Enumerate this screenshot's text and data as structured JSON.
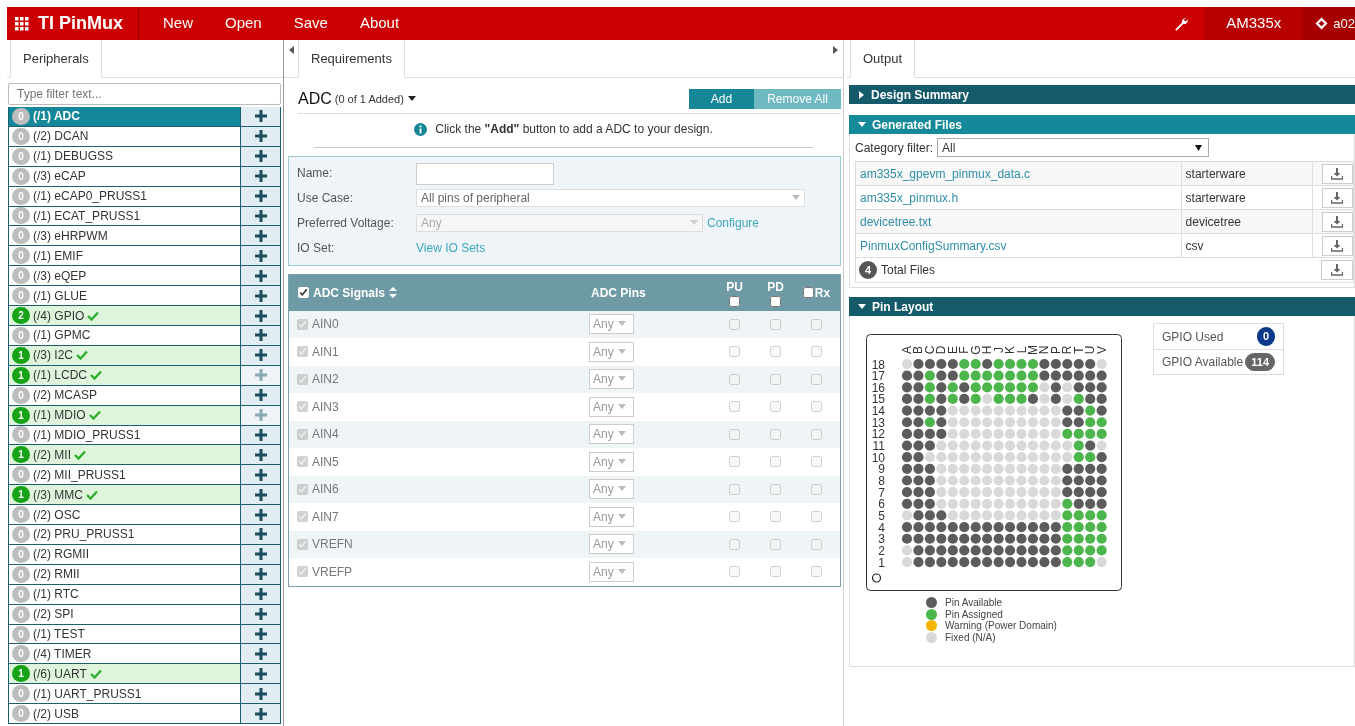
{
  "header": {
    "brand": "TI PinMux",
    "menu": [
      "New",
      "Open",
      "Save",
      "About"
    ],
    "device": "AM335x",
    "user": "a02"
  },
  "peripherals": {
    "tab": {
      "label": "Peripherals",
      "selected": true
    },
    "filter": {
      "placeholder": "Type filter text..."
    },
    "items": [
      {
        "count": "0",
        "label": "(/1) ADC",
        "assigned": false,
        "selected": true,
        "add_disabled": false
      },
      {
        "count": "0",
        "label": "(/2) DCAN",
        "assigned": false,
        "selected": false,
        "add_disabled": false
      },
      {
        "count": "0",
        "label": "(/1) DEBUGSS",
        "assigned": false,
        "selected": false,
        "add_disabled": false
      },
      {
        "count": "0",
        "label": "(/3) eCAP",
        "assigned": false,
        "selected": false,
        "add_disabled": false
      },
      {
        "count": "0",
        "label": "(/1) eCAP0_PRUSS1",
        "assigned": false,
        "selected": false,
        "add_disabled": false
      },
      {
        "count": "0",
        "label": "(/1) ECAT_PRUSS1",
        "assigned": false,
        "selected": false,
        "add_disabled": false
      },
      {
        "count": "0",
        "label": "(/3) eHRPWM",
        "assigned": false,
        "selected": false,
        "add_disabled": false
      },
      {
        "count": "0",
        "label": "(/1) EMIF",
        "assigned": false,
        "selected": false,
        "add_disabled": false
      },
      {
        "count": "0",
        "label": "(/3) eQEP",
        "assigned": false,
        "selected": false,
        "add_disabled": false
      },
      {
        "count": "0",
        "label": "(/1) GLUE",
        "assigned": false,
        "selected": false,
        "add_disabled": false
      },
      {
        "count": "2",
        "label": "(/4) GPIO",
        "assigned": true,
        "selected": false,
        "add_disabled": false
      },
      {
        "count": "0",
        "label": "(/1) GPMC",
        "assigned": false,
        "selected": false,
        "add_disabled": false
      },
      {
        "count": "1",
        "label": "(/3) I2C",
        "assigned": true,
        "selected": false,
        "add_disabled": false
      },
      {
        "count": "1",
        "label": "(/1) LCDC",
        "assigned": true,
        "selected": false,
        "add_disabled": true
      },
      {
        "count": "0",
        "label": "(/2) MCASP",
        "assigned": false,
        "selected": false,
        "add_disabled": false
      },
      {
        "count": "1",
        "label": "(/1) MDIO",
        "assigned": true,
        "selected": false,
        "add_disabled": true
      },
      {
        "count": "0",
        "label": "(/1) MDIO_PRUSS1",
        "assigned": false,
        "selected": false,
        "add_disabled": false
      },
      {
        "count": "1",
        "label": "(/2) MII",
        "assigned": true,
        "selected": false,
        "add_disabled": false
      },
      {
        "count": "0",
        "label": "(/2) MII_PRUSS1",
        "assigned": false,
        "selected": false,
        "add_disabled": false
      },
      {
        "count": "1",
        "label": "(/3) MMC",
        "assigned": true,
        "selected": false,
        "add_disabled": false
      },
      {
        "count": "0",
        "label": "(/2) OSC",
        "assigned": false,
        "selected": false,
        "add_disabled": false
      },
      {
        "count": "0",
        "label": "(/2) PRU_PRUSS1",
        "assigned": false,
        "selected": false,
        "add_disabled": false
      },
      {
        "count": "0",
        "label": "(/2) RGMII",
        "assigned": false,
        "selected": false,
        "add_disabled": false
      },
      {
        "count": "0",
        "label": "(/2) RMII",
        "assigned": false,
        "selected": false,
        "add_disabled": false
      },
      {
        "count": "0",
        "label": "(/1) RTC",
        "assigned": false,
        "selected": false,
        "add_disabled": false
      },
      {
        "count": "0",
        "label": "(/2) SPI",
        "assigned": false,
        "selected": false,
        "add_disabled": false
      },
      {
        "count": "0",
        "label": "(/1) TEST",
        "assigned": false,
        "selected": false,
        "add_disabled": false
      },
      {
        "count": "0",
        "label": "(/4) TIMER",
        "assigned": false,
        "selected": false,
        "add_disabled": false
      },
      {
        "count": "1",
        "label": "(/6) UART",
        "assigned": true,
        "selected": false,
        "add_disabled": false
      },
      {
        "count": "0",
        "label": "(/1) UART_PRUSS1",
        "assigned": false,
        "selected": false,
        "add_disabled": false
      },
      {
        "count": "0",
        "label": "(/2) USB",
        "assigned": false,
        "selected": false,
        "add_disabled": false
      }
    ]
  },
  "requirements": {
    "tab": {
      "label": "Requirements",
      "selected": true
    },
    "title": "ADC",
    "subtitle": "(0 of 1 Added)",
    "buttons": [
      {
        "label": "Add",
        "disabled": false
      },
      {
        "label": "Remove All",
        "disabled": true
      }
    ],
    "info": "Click the **\"Add\"** button to add a ADC to your design.",
    "form": {
      "name": {
        "label": "Name:"
      },
      "use_case": {
        "label": "Use Case:",
        "value": "All pins of peripheral",
        "disabled": false
      },
      "voltage": {
        "label": "Preferred Voltage:",
        "value": "Any",
        "disabled": true,
        "link": "Configure"
      },
      "io_set": {
        "label": "IO Set:",
        "link": "View IO Sets"
      }
    },
    "signals": {
      "header": {
        "label": "ADC Signals",
        "checked": true,
        "pins": "ADC Pins",
        "pu": "PU",
        "pu_checked": false,
        "pd": "PD",
        "pd_checked": false,
        "rx": "Rx",
        "rx_checked": false
      },
      "rows": [
        {
          "name": "AIN0",
          "checked": true,
          "pin": "Any",
          "pu": false,
          "pd": false,
          "rx": false
        },
        {
          "name": "AIN1",
          "checked": true,
          "pin": "Any",
          "pu": false,
          "pd": false,
          "rx": false
        },
        {
          "name": "AIN2",
          "checked": true,
          "pin": "Any",
          "pu": false,
          "pd": false,
          "rx": false
        },
        {
          "name": "AIN3",
          "checked": true,
          "pin": "Any",
          "pu": false,
          "pd": false,
          "rx": false
        },
        {
          "name": "AIN4",
          "checked": true,
          "pin": "Any",
          "pu": false,
          "pd": false,
          "rx": false
        },
        {
          "name": "AIN5",
          "checked": true,
          "pin": "Any",
          "pu": false,
          "pd": false,
          "rx": false
        },
        {
          "name": "AIN6",
          "checked": true,
          "pin": "Any",
          "pu": false,
          "pd": false,
          "rx": false
        },
        {
          "name": "AIN7",
          "checked": true,
          "pin": "Any",
          "pu": false,
          "pd": false,
          "rx": false
        },
        {
          "name": "VREFN",
          "checked": true,
          "pin": "Any",
          "pu": false,
          "pd": false,
          "rx": false
        },
        {
          "name": "VREFP",
          "checked": true,
          "pin": "Any",
          "pu": false,
          "pd": false,
          "rx": false
        }
      ]
    }
  },
  "output": {
    "tab": {
      "label": "Output",
      "selected": true
    },
    "design_summary": {
      "title": "Design Summary",
      "expanded": false,
      "highlighted": false
    },
    "generated_files": {
      "title": "Generated Files",
      "expanded": true,
      "highlighted": true,
      "filter_label": "Category filter:",
      "filter_value": "All",
      "files": [
        {
          "name": "am335x_gpevm_pinmux_data.c",
          "category": "starterware"
        },
        {
          "name": "am335x_pinmux.h",
          "category": "starterware"
        },
        {
          "name": "devicetree.txt",
          "category": "devicetree"
        },
        {
          "name": "PinmuxConfigSummary.csv",
          "category": "csv"
        }
      ],
      "total_count": "4",
      "total_label": "Total Files"
    },
    "pin_layout": {
      "title": "Pin Layout",
      "expanded": true,
      "highlighted": false,
      "columns": [
        "A",
        "B",
        "C",
        "D",
        "E",
        "F",
        "G",
        "H",
        "J",
        "K",
        "L",
        "M",
        "N",
        "P",
        "R",
        "T",
        "U",
        "V"
      ],
      "rows": [
        {
          "label": "18",
          "pins": [
            {
              "color": "#d9d9d9"
            },
            {
              "color": "#5c5c5c"
            },
            {
              "color": "#5c5c5c"
            },
            {
              "color": "#5c5c5c"
            },
            {
              "color": "#5c5c5c"
            },
            {
              "color": "#4cb54c"
            },
            {
              "color": "#4cb54c"
            },
            {
              "color": "#5c5c5c"
            },
            {
              "color": "#4cb54c"
            },
            {
              "color": "#4cb54c"
            },
            {
              "color": "#4cb54c"
            },
            {
              "color": "#4cb54c"
            },
            {
              "color": "#5c5c5c"
            },
            {
              "color": "#5c5c5c"
            },
            {
              "color": "#5c5c5c"
            },
            {
              "color": "#5c5c5c"
            },
            {
              "color": "#5c5c5c"
            },
            {
              "color": "#d9d9d9"
            }
          ]
        },
        {
          "label": "17",
          "pins": [
            {
              "color": "#5c5c5c"
            },
            {
              "color": "#5c5c5c"
            },
            {
              "color": "#4cb54c"
            },
            {
              "color": "#5c5c5c"
            },
            {
              "color": "#5c5c5c"
            },
            {
              "color": "#4cb54c"
            },
            {
              "color": "#4cb54c"
            },
            {
              "color": "#4cb54c"
            },
            {
              "color": "#4cb54c"
            },
            {
              "color": "#4cb54c"
            },
            {
              "color": "#4cb54c"
            },
            {
              "color": "#4cb54c"
            },
            {
              "color": "#5c5c5c"
            },
            {
              "color": "#5c5c5c"
            },
            {
              "color": "#5c5c5c"
            },
            {
              "color": "#5c5c5c"
            },
            {
              "color": "#5c5c5c"
            },
            {
              "color": "#5c5c5c"
            }
          ]
        },
        {
          "label": "16",
          "pins": [
            {
              "color": "#5c5c5c"
            },
            {
              "color": "#5c5c5c"
            },
            {
              "color": "#4cb54c"
            },
            {
              "color": "#5c5c5c"
            },
            {
              "color": "#4cb54c"
            },
            {
              "color": "#5c5c5c"
            },
            {
              "color": "#4cb54c"
            },
            {
              "color": "#4cb54c"
            },
            {
              "color": "#4cb54c"
            },
            {
              "color": "#4cb54c"
            },
            {
              "color": "#4cb54c"
            },
            {
              "color": "#4cb54c"
            },
            {
              "color": "#d9d9d9"
            },
            {
              "color": "#5c5c5c"
            },
            {
              "color": "#d9d9d9"
            },
            {
              "color": "#5c5c5c"
            },
            {
              "color": "#5c5c5c"
            },
            {
              "color": "#5c5c5c"
            }
          ]
        },
        {
          "label": "15",
          "pins": [
            {
              "color": "#5c5c5c"
            },
            {
              "color": "#5c5c5c"
            },
            {
              "color": "#4cb54c"
            },
            {
              "color": "#5c5c5c"
            },
            {
              "color": "#4cb54c"
            },
            {
              "color": "#5c5c5c"
            },
            {
              "color": "#4cb54c"
            },
            {
              "color": "#d9d9d9"
            },
            {
              "color": "#4cb54c"
            },
            {
              "color": "#4cb54c"
            },
            {
              "color": "#4cb54c"
            },
            {
              "color": "#5c5c5c"
            },
            {
              "color": "#d9d9d9"
            },
            {
              "color": "#5c5c5c"
            },
            {
              "color": "#d9d9d9"
            },
            {
              "color": "#4cb54c"
            },
            {
              "color": "#5c5c5c"
            },
            {
              "color": "#5c5c5c"
            }
          ]
        },
        {
          "label": "14",
          "pins": [
            {
              "color": "#5c5c5c"
            },
            {
              "color": "#5c5c5c"
            },
            {
              "color": "#5c5c5c"
            },
            {
              "color": "#5c5c5c"
            },
            {
              "color": "#d9d9d9"
            },
            {
              "color": "#d9d9d9"
            },
            {
              "color": "#d9d9d9"
            },
            {
              "color": "#d9d9d9"
            },
            {
              "color": "#d9d9d9"
            },
            {
              "color": "#d9d9d9"
            },
            {
              "color": "#d9d9d9"
            },
            {
              "color": "#d9d9d9"
            },
            {
              "color": "#d9d9d9"
            },
            {
              "color": "#d9d9d9"
            },
            {
              "color": "#5c5c5c"
            },
            {
              "color": "#5c5c5c"
            },
            {
              "color": "#4cb54c"
            },
            {
              "color": "#5c5c5c"
            }
          ]
        },
        {
          "label": "13",
          "pins": [
            {
              "color": "#5c5c5c"
            },
            {
              "color": "#5c5c5c"
            },
            {
              "color": "#4cb54c"
            },
            {
              "color": "#5c5c5c"
            },
            {
              "color": "#d9d9d9"
            },
            {
              "color": "#d9d9d9"
            },
            {
              "color": "#d9d9d9"
            },
            {
              "color": "#d9d9d9"
            },
            {
              "color": "#d9d9d9"
            },
            {
              "color": "#d9d9d9"
            },
            {
              "color": "#d9d9d9"
            },
            {
              "color": "#d9d9d9"
            },
            {
              "color": "#d9d9d9"
            },
            {
              "color": "#d9d9d9"
            },
            {
              "color": "#5c5c5c"
            },
            {
              "color": "#5c5c5c"
            },
            {
              "color": "#4cb54c"
            },
            {
              "color": "#4cb54c"
            }
          ]
        },
        {
          "label": "12",
          "pins": [
            {
              "color": "#5c5c5c"
            },
            {
              "color": "#5c5c5c"
            },
            {
              "color": "#5c5c5c"
            },
            {
              "color": "#5c5c5c"
            },
            {
              "color": "#d9d9d9"
            },
            {
              "color": "#d9d9d9"
            },
            {
              "color": "#d9d9d9"
            },
            {
              "color": "#d9d9d9"
            },
            {
              "color": "#d9d9d9"
            },
            {
              "color": "#d9d9d9"
            },
            {
              "color": "#d9d9d9"
            },
            {
              "color": "#d9d9d9"
            },
            {
              "color": "#d9d9d9"
            },
            {
              "color": "#d9d9d9"
            },
            {
              "color": "#4cb54c"
            },
            {
              "color": "#4cb54c"
            },
            {
              "color": "#4cb54c"
            },
            {
              "color": "#4cb54c"
            }
          ]
        },
        {
          "label": "11",
          "pins": [
            {
              "color": "#5c5c5c"
            },
            {
              "color": "#5c5c5c"
            },
            {
              "color": "#5c5c5c"
            },
            {
              "color": "#d9d9d9"
            },
            {
              "color": "#d9d9d9"
            },
            {
              "color": "#d9d9d9"
            },
            {
              "color": "#d9d9d9"
            },
            {
              "color": "#d9d9d9"
            },
            {
              "color": "#d9d9d9"
            },
            {
              "color": "#d9d9d9"
            },
            {
              "color": "#d9d9d9"
            },
            {
              "color": "#d9d9d9"
            },
            {
              "color": "#d9d9d9"
            },
            {
              "color": "#d9d9d9"
            },
            {
              "color": "#d9d9d9"
            },
            {
              "color": "#4cb54c"
            },
            {
              "color": "#5c5c5c"
            },
            {
              "color": "#d9d9d9"
            }
          ]
        },
        {
          "label": "10",
          "pins": [
            {
              "color": "#5c5c5c"
            },
            {
              "color": "#5c5c5c"
            },
            {
              "color": "#d9d9d9"
            },
            {
              "color": "#d9d9d9"
            },
            {
              "color": "#d9d9d9"
            },
            {
              "color": "#d9d9d9"
            },
            {
              "color": "#d9d9d9"
            },
            {
              "color": "#d9d9d9"
            },
            {
              "color": "#d9d9d9"
            },
            {
              "color": "#d9d9d9"
            },
            {
              "color": "#d9d9d9"
            },
            {
              "color": "#d9d9d9"
            },
            {
              "color": "#d9d9d9"
            },
            {
              "color": "#d9d9d9"
            },
            {
              "color": "#d9d9d9"
            },
            {
              "color": "#4cb54c"
            },
            {
              "color": "#4cb54c"
            },
            {
              "color": "#5c5c5c"
            }
          ]
        },
        {
          "label": "9",
          "pins": [
            {
              "color": "#5c5c5c"
            },
            {
              "color": "#5c5c5c"
            },
            {
              "color": "#5c5c5c"
            },
            {
              "color": "#d9d9d9"
            },
            {
              "color": "#d9d9d9"
            },
            {
              "color": "#d9d9d9"
            },
            {
              "color": "#d9d9d9"
            },
            {
              "color": "#d9d9d9"
            },
            {
              "color": "#d9d9d9"
            },
            {
              "color": "#d9d9d9"
            },
            {
              "color": "#d9d9d9"
            },
            {
              "color": "#d9d9d9"
            },
            {
              "color": "#d9d9d9"
            },
            {
              "color": "#d9d9d9"
            },
            {
              "color": "#5c5c5c"
            },
            {
              "color": "#5c5c5c"
            },
            {
              "color": "#5c5c5c"
            },
            {
              "color": "#5c5c5c"
            }
          ]
        },
        {
          "label": "8",
          "pins": [
            {
              "color": "#5c5c5c"
            },
            {
              "color": "#5c5c5c"
            },
            {
              "color": "#5c5c5c"
            },
            {
              "color": "#d9d9d9"
            },
            {
              "color": "#d9d9d9"
            },
            {
              "color": "#d9d9d9"
            },
            {
              "color": "#d9d9d9"
            },
            {
              "color": "#d9d9d9"
            },
            {
              "color": "#d9d9d9"
            },
            {
              "color": "#d9d9d9"
            },
            {
              "color": "#d9d9d9"
            },
            {
              "color": "#d9d9d9"
            },
            {
              "color": "#d9d9d9"
            },
            {
              "color": "#d9d9d9"
            },
            {
              "color": "#5c5c5c"
            },
            {
              "color": "#5c5c5c"
            },
            {
              "color": "#5c5c5c"
            },
            {
              "color": "#5c5c5c"
            }
          ]
        },
        {
          "label": "7",
          "pins": [
            {
              "color": "#5c5c5c"
            },
            {
              "color": "#5c5c5c"
            },
            {
              "color": "#5c5c5c"
            },
            {
              "color": "#d9d9d9"
            },
            {
              "color": "#d9d9d9"
            },
            {
              "color": "#d9d9d9"
            },
            {
              "color": "#d9d9d9"
            },
            {
              "color": "#d9d9d9"
            },
            {
              "color": "#d9d9d9"
            },
            {
              "color": "#d9d9d9"
            },
            {
              "color": "#d9d9d9"
            },
            {
              "color": "#d9d9d9"
            },
            {
              "color": "#d9d9d9"
            },
            {
              "color": "#d9d9d9"
            },
            {
              "color": "#5c5c5c"
            },
            {
              "color": "#5c5c5c"
            },
            {
              "color": "#5c5c5c"
            },
            {
              "color": "#5c5c5c"
            }
          ]
        },
        {
          "label": "6",
          "pins": [
            {
              "color": "#5c5c5c"
            },
            {
              "color": "#5c5c5c"
            },
            {
              "color": "#5c5c5c"
            },
            {
              "color": "#d9d9d9"
            },
            {
              "color": "#d9d9d9"
            },
            {
              "color": "#d9d9d9"
            },
            {
              "color": "#d9d9d9"
            },
            {
              "color": "#d9d9d9"
            },
            {
              "color": "#d9d9d9"
            },
            {
              "color": "#d9d9d9"
            },
            {
              "color": "#d9d9d9"
            },
            {
              "color": "#d9d9d9"
            },
            {
              "color": "#d9d9d9"
            },
            {
              "color": "#d9d9d9"
            },
            {
              "color": "#4cb54c"
            },
            {
              "color": "#5c5c5c"
            },
            {
              "color": "#5c5c5c"
            },
            {
              "color": "#5c5c5c"
            }
          ]
        },
        {
          "label": "5",
          "pins": [
            {
              "color": "#d9d9d9"
            },
            {
              "color": "#5c5c5c"
            },
            {
              "color": "#5c5c5c"
            },
            {
              "color": "#5c5c5c"
            },
            {
              "color": "#d9d9d9"
            },
            {
              "color": "#d9d9d9"
            },
            {
              "color": "#d9d9d9"
            },
            {
              "color": "#d9d9d9"
            },
            {
              "color": "#d9d9d9"
            },
            {
              "color": "#d9d9d9"
            },
            {
              "color": "#d9d9d9"
            },
            {
              "color": "#d9d9d9"
            },
            {
              "color": "#d9d9d9"
            },
            {
              "color": "#d9d9d9"
            },
            {
              "color": "#4cb54c"
            },
            {
              "color": "#4cb54c"
            },
            {
              "color": "#4cb54c"
            },
            {
              "color": "#4cb54c"
            }
          ]
        },
        {
          "label": "4",
          "pins": [
            {
              "color": "#5c5c5c"
            },
            {
              "color": "#5c5c5c"
            },
            {
              "color": "#5c5c5c"
            },
            {
              "color": "#5c5c5c"
            },
            {
              "color": "#5c5c5c"
            },
            {
              "color": "#5c5c5c"
            },
            {
              "color": "#5c5c5c"
            },
            {
              "color": "#5c5c5c"
            },
            {
              "color": "#5c5c5c"
            },
            {
              "color": "#5c5c5c"
            },
            {
              "color": "#5c5c5c"
            },
            {
              "color": "#5c5c5c"
            },
            {
              "color": "#5c5c5c"
            },
            {
              "color": "#5c5c5c"
            },
            {
              "color": "#4cb54c"
            },
            {
              "color": "#4cb54c"
            },
            {
              "color": "#4cb54c"
            },
            {
              "color": "#4cb54c"
            }
          ]
        },
        {
          "label": "3",
          "pins": [
            {
              "color": "#5c5c5c"
            },
            {
              "color": "#5c5c5c"
            },
            {
              "color": "#5c5c5c"
            },
            {
              "color": "#5c5c5c"
            },
            {
              "color": "#5c5c5c"
            },
            {
              "color": "#5c5c5c"
            },
            {
              "color": "#5c5c5c"
            },
            {
              "color": "#5c5c5c"
            },
            {
              "color": "#5c5c5c"
            },
            {
              "color": "#5c5c5c"
            },
            {
              "color": "#5c5c5c"
            },
            {
              "color": "#5c5c5c"
            },
            {
              "color": "#5c5c5c"
            },
            {
              "color": "#5c5c5c"
            },
            {
              "color": "#4cb54c"
            },
            {
              "color": "#4cb54c"
            },
            {
              "color": "#4cb54c"
            },
            {
              "color": "#4cb54c"
            }
          ]
        },
        {
          "label": "2",
          "pins": [
            {
              "color": "#d9d9d9"
            },
            {
              "color": "#5c5c5c"
            },
            {
              "color": "#5c5c5c"
            },
            {
              "color": "#5c5c5c"
            },
            {
              "color": "#5c5c5c"
            },
            {
              "color": "#5c5c5c"
            },
            {
              "color": "#5c5c5c"
            },
            {
              "color": "#5c5c5c"
            },
            {
              "color": "#5c5c5c"
            },
            {
              "color": "#5c5c5c"
            },
            {
              "color": "#5c5c5c"
            },
            {
              "color": "#5c5c5c"
            },
            {
              "color": "#5c5c5c"
            },
            {
              "color": "#5c5c5c"
            },
            {
              "color": "#4cb54c"
            },
            {
              "color": "#4cb54c"
            },
            {
              "color": "#4cb54c"
            },
            {
              "color": "#4cb54c"
            }
          ]
        },
        {
          "label": "1",
          "pins": [
            {
              "color": "#d9d9d9"
            },
            {
              "color": "#5c5c5c"
            },
            {
              "color": "#5c5c5c"
            },
            {
              "color": "#5c5c5c"
            },
            {
              "color": "#5c5c5c"
            },
            {
              "color": "#5c5c5c"
            },
            {
              "color": "#5c5c5c"
            },
            {
              "color": "#5c5c5c"
            },
            {
              "color": "#5c5c5c"
            },
            {
              "color": "#5c5c5c"
            },
            {
              "color": "#5c5c5c"
            },
            {
              "color": "#5c5c5c"
            },
            {
              "color": "#5c5c5c"
            },
            {
              "color": "#5c5c5c"
            },
            {
              "color": "#4cb54c"
            },
            {
              "color": "#4cb54c"
            },
            {
              "color": "#4cb54c"
            },
            {
              "color": "#d9d9d9"
            }
          ]
        }
      ],
      "legend": [
        {
          "label": "Pin Available",
          "color": "#5c5c5c"
        },
        {
          "label": "Pin Assigned",
          "color": "#4cb54c"
        },
        {
          "label": "Warning (Power Domain)",
          "color": "#f7b500"
        },
        {
          "label": "Fixed (N/A)",
          "color": "#d9d9d9"
        }
      ],
      "stats": [
        {
          "label": "GPIO Used",
          "value": "0",
          "kind": "used"
        },
        {
          "label": "GPIO Available",
          "value": "114",
          "kind": "available"
        }
      ]
    }
  }
}
